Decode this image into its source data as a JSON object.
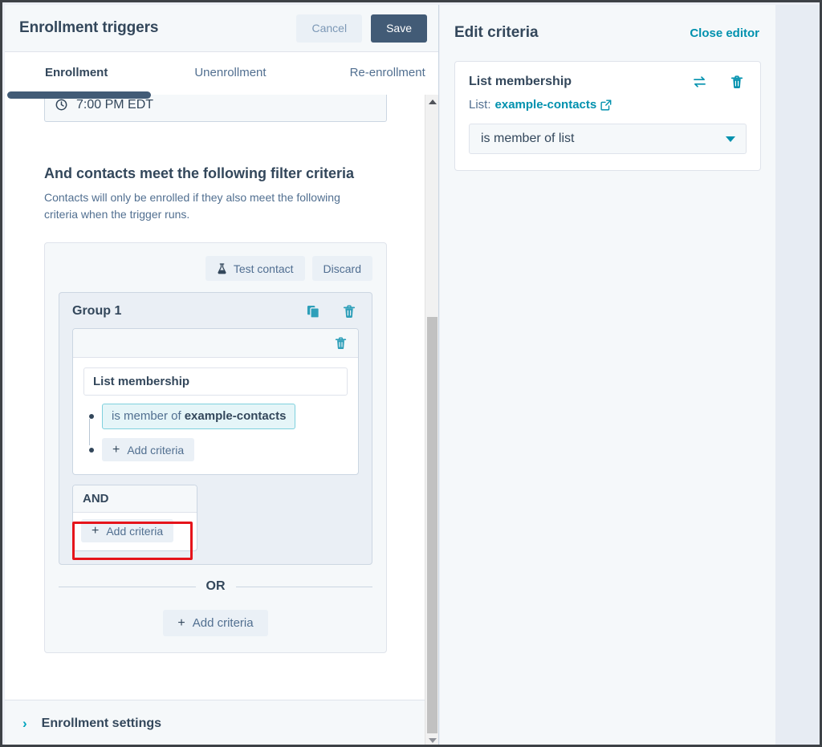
{
  "header": {
    "title": "Enrollment triggers",
    "cancel_label": "Cancel",
    "save_label": "Save"
  },
  "tabs": [
    {
      "label": "Enrollment",
      "active": true
    },
    {
      "label": "Unenrollment",
      "active": false
    },
    {
      "label": "Re-enrollment",
      "active": false
    }
  ],
  "time_field": {
    "icon": "clock-icon",
    "value": "7:00 PM EDT"
  },
  "filter_section": {
    "heading": "And contacts meet the following filter criteria",
    "subtext": "Contacts will only be enrolled if they also meet the following criteria when the trigger runs.",
    "test_contact_label": "Test contact",
    "discard_label": "Discard"
  },
  "group": {
    "title": "Group 1",
    "duplicate_icon": "duplicate-icon",
    "delete_icon": "trash-icon",
    "filter_card": {
      "delete_icon": "trash-icon",
      "name": "List membership",
      "condition_prefix": "is member of",
      "condition_value": "example-contacts",
      "add_criteria_label": "Add criteria"
    },
    "and_label": "AND",
    "and_add_criteria_label": "Add criteria"
  },
  "or_label": "OR",
  "bottom_add_criteria_label": "Add criteria",
  "enrollment_settings": {
    "label": "Enrollment settings",
    "chevron": "›"
  },
  "editor": {
    "title": "Edit criteria",
    "close_label": "Close editor",
    "card": {
      "title": "List membership",
      "swap_icon": "swap-icon",
      "delete_icon": "trash-icon",
      "list_label": "List:",
      "list_name": "example-contacts",
      "external_link_icon": "external-link-icon",
      "operator_value": "is member of list"
    }
  },
  "colors": {
    "accent_teal": "#0091ae",
    "dark_navy": "#33475b",
    "save_button": "#425b76",
    "highlight_red": "#e5141b",
    "chip_bg": "#e5f5f8",
    "chip_border": "#7fd1de"
  }
}
